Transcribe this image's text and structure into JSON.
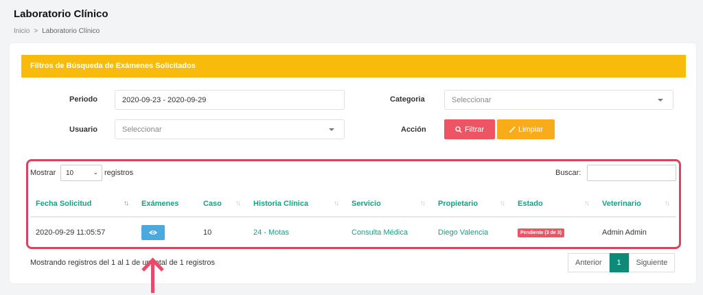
{
  "page": {
    "title": "Laboratorio Clínico",
    "breadcrumb": [
      "Inicio",
      ">",
      "Laboratorio Clínico"
    ]
  },
  "filters": {
    "header": "Filtros de Búsqueda de Exámenes Solicitados",
    "periodo_label": "Periodo",
    "periodo_value": "2020-09-23 - 2020-09-29",
    "categoria_label": "Categoria",
    "categoria_placeholder": "Seleccionar",
    "usuario_label": "Usuario",
    "usuario_placeholder": "Seleccionar",
    "accion_label": "Acción",
    "filtrar_label": "Filtrar",
    "limpiar_label": "Limpiar"
  },
  "table": {
    "show_prefix": "Mostrar",
    "show_value": "10",
    "show_suffix": "registros",
    "search_label": "Buscar:",
    "columns": [
      "Fecha Solicitud",
      "Exámenes",
      "Caso",
      "Historia Clínica",
      "Servicio",
      "Propietario",
      "Estado",
      "Veterinario"
    ],
    "rows": [
      {
        "fecha": "2020-09-29 11:05:57",
        "caso": "10",
        "historia": "24 - Motas",
        "servicio": "Consulta Médica",
        "propietario": "Diego Valencia",
        "estado": "Pendiente (3 de 3)",
        "veterinario": "Admin Admin"
      }
    ],
    "info": "Mostrando registros del 1 al 1 de un total de 1 registros",
    "pagination": {
      "prev": "Anterior",
      "current": "1",
      "next": "Siguiente"
    }
  },
  "colors": {
    "header_yellow": "#f9bb0b",
    "teal": "#14a085",
    "red": "#ed5565",
    "highlight": "#d64560"
  },
  "icons": [
    "search-icon",
    "brush-icon",
    "eye-icon",
    "caret-down-icon",
    "sort-icon",
    "arrow-up-icon"
  ]
}
